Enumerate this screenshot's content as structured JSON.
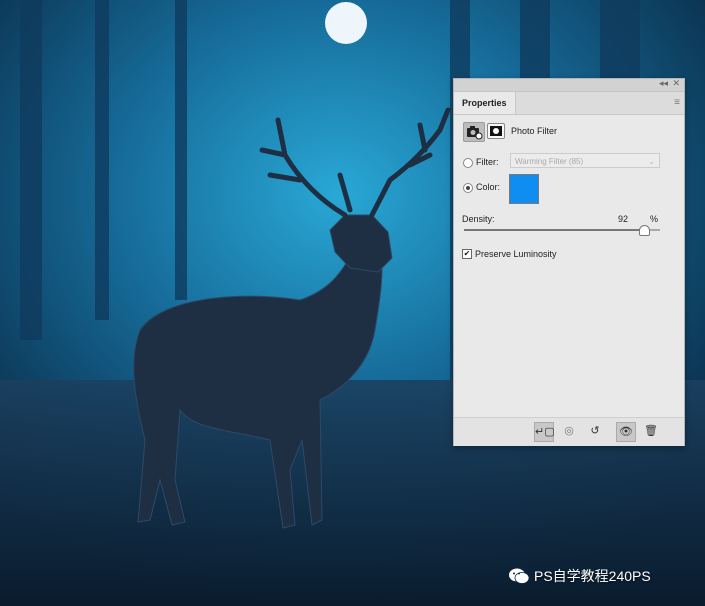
{
  "panel": {
    "tab_label": "Properties",
    "collapse_glyph": "◂◂",
    "close_glyph": "✕",
    "menu_glyph": "≡",
    "adjustment_title": "Photo Filter",
    "filter_label": "Filter:",
    "filter_value": "Warming Filter (85)",
    "color_label": "Color:",
    "color_value": "#0f8df1",
    "density_label": "Density:",
    "density_value": "92",
    "density_unit": "%",
    "density_level": 0.92,
    "preserve_label": "Preserve Luminosity",
    "preserve_checked": true
  },
  "toolbar": {
    "clip_glyph": "↵▢",
    "prev_glyph": "◎",
    "reset_glyph": "↺",
    "visibility_glyph": "👁",
    "delete_glyph": "🗑"
  },
  "watermark": {
    "text": "PS自学教程240PS"
  }
}
